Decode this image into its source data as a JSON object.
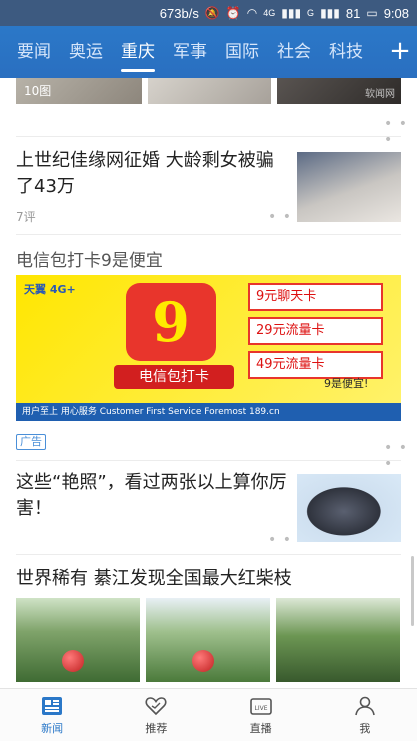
{
  "status_bar": {
    "speed": "673b/s",
    "signal_label_1": "4G",
    "signal_label_2": "G",
    "battery": "81",
    "time": "9:08"
  },
  "tabs": [
    {
      "label": "要闻",
      "active": false
    },
    {
      "label": "奥运",
      "active": false
    },
    {
      "label": "重庆",
      "active": true
    },
    {
      "label": "军事",
      "active": false
    },
    {
      "label": "国际",
      "active": false
    },
    {
      "label": "社会",
      "active": false
    },
    {
      "label": "科技",
      "active": false
    }
  ],
  "tab_add_label": "+",
  "top_strip": {
    "image_count": "10图",
    "watermark": "软闻网"
  },
  "news": [
    {
      "title": "上世纪佳缘网征婚 大龄剩女被骗了43万",
      "meta": "7评"
    },
    {
      "title": "这些“艳照”，看过两张以上算你厉害！",
      "meta": ""
    },
    {
      "title": "世界稀有 綦江发现全国最大红柴枝",
      "meta": ""
    }
  ],
  "ad": {
    "title": "电信包打卡9是便宜",
    "brand": "天翼 4G+",
    "big_number": "9",
    "slogan": "电信包打卡",
    "card_1": "9元聊天卡",
    "card_2": "29元流量卡",
    "card_3": "49元流量卡",
    "handwriting": "9是便宜!",
    "footer": "用户至上 用心服务 Customer First Service Foremost 189.cn",
    "tag": "广告"
  },
  "more_dots": "• • •",
  "bottom_nav": [
    {
      "label": "新闻",
      "icon": "news-icon",
      "active": true
    },
    {
      "label": "推荐",
      "icon": "heart-icon",
      "active": false
    },
    {
      "label": "直播",
      "icon": "live-tv-icon",
      "active": false
    },
    {
      "label": "我",
      "icon": "user-icon",
      "active": false
    }
  ],
  "colors": {
    "accent": "#2b78c8",
    "ad_red": "#e8352c",
    "ad_yellow": "#ffe600"
  }
}
